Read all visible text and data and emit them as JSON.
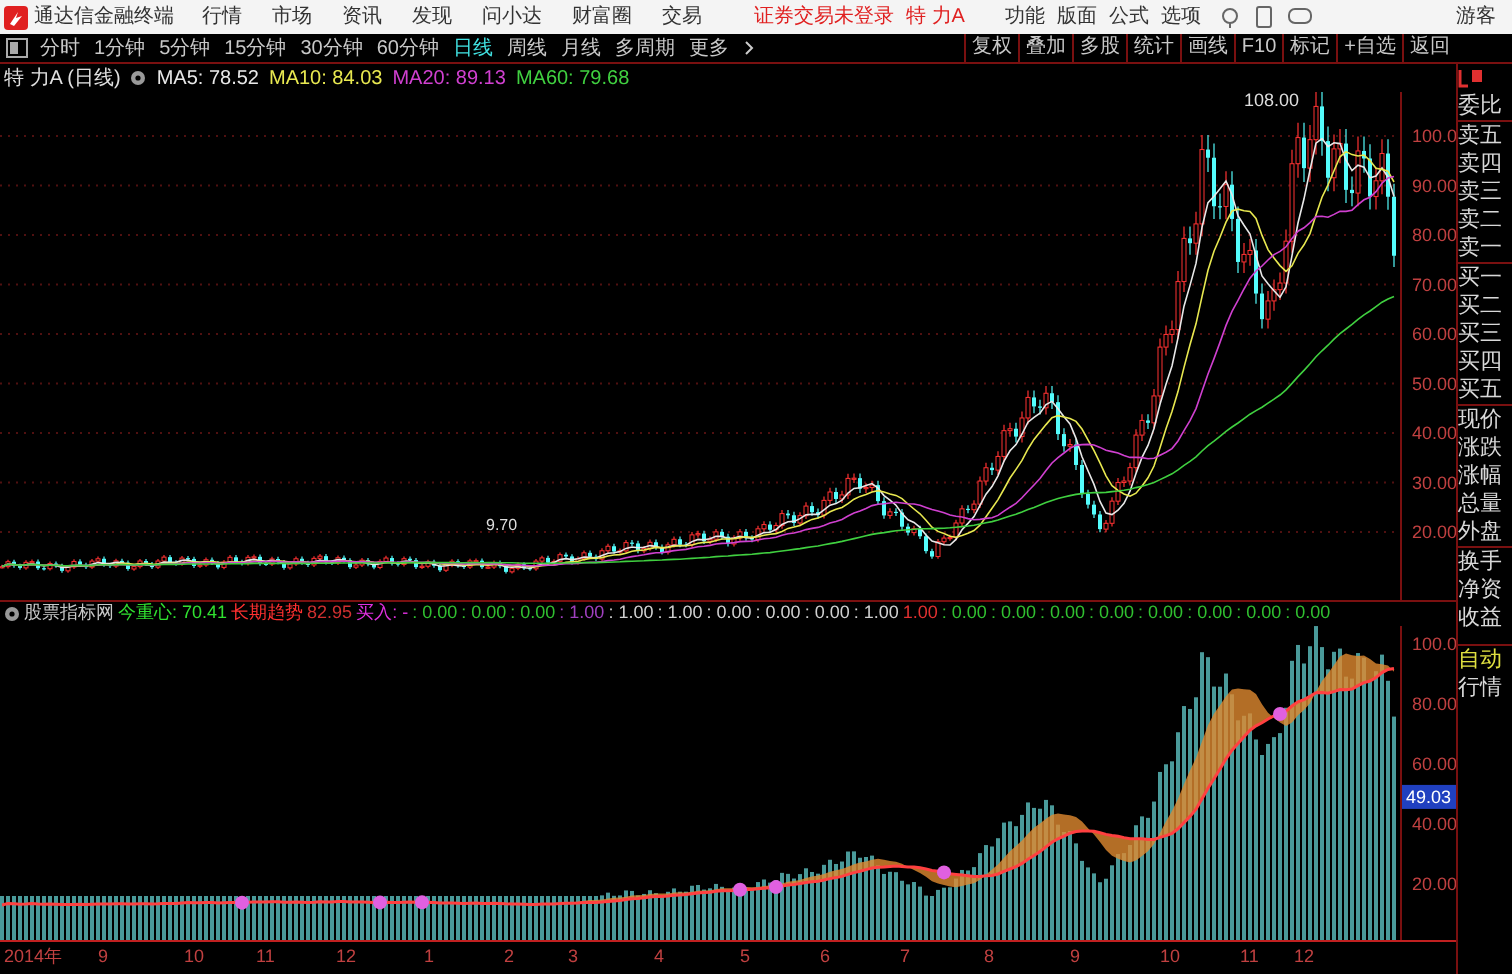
{
  "title_bar": {
    "app_name": "通达信金融终端",
    "menus": [
      "行情",
      "市场",
      "资讯",
      "发现",
      "问小达",
      "财富圈",
      "交易"
    ],
    "login_status": "证券交易未登录",
    "stock": "特 力A",
    "tools": [
      "功能",
      "版面",
      "公式",
      "选项"
    ],
    "user": "游客"
  },
  "period_tabs": [
    {
      "label": "分时",
      "selected": false
    },
    {
      "label": "1分钟",
      "selected": false
    },
    {
      "label": "5分钟",
      "selected": false
    },
    {
      "label": "15分钟",
      "selected": false
    },
    {
      "label": "30分钟",
      "selected": false
    },
    {
      "label": "60分钟",
      "selected": false
    },
    {
      "label": "日线",
      "selected": true
    },
    {
      "label": "周线",
      "selected": false
    },
    {
      "label": "月线",
      "selected": false
    },
    {
      "label": "多周期",
      "selected": false
    },
    {
      "label": "更多",
      "selected": false
    }
  ],
  "toolbar_buttons": [
    "复权",
    "叠加",
    "多股",
    "统计",
    "画线",
    "F10",
    "标记",
    "+自选",
    "返回"
  ],
  "chart_header": {
    "stock": "特 力A (日线)",
    "indicators": [
      {
        "label": "MA5: 78.52",
        "color": "#e8e8e8"
      },
      {
        "label": "MA10: 84.03",
        "color": "#e8e850"
      },
      {
        "label": "MA20: 89.13",
        "color": "#d040d0"
      },
      {
        "label": "MA60: 79.68",
        "color": "#40d040"
      }
    ]
  },
  "price_axis": [
    "100.0",
    "90.00",
    "80.00",
    "70.00",
    "60.00",
    "50.00",
    "40.00",
    "30.00",
    "20.00"
  ],
  "high_label": "108.00",
  "low_label": "9.70",
  "indicator_panel": {
    "name": "股票指标网",
    "values": [
      {
        "text": "今重心: 70.41",
        "color": "#30e030"
      },
      {
        "text": "长期趋势",
        "color": "#ff3030"
      },
      {
        "text": "82.95",
        "color": "#d03030"
      },
      {
        "text": "买入: -",
        "color": "#e030e0"
      },
      {
        "text": ": 0.00",
        "color": "#30c030"
      },
      {
        "text": ": 0.00",
        "color": "#30c030"
      },
      {
        "text": ": 0.00",
        "color": "#30c030"
      },
      {
        "text": ": 1.00",
        "color": "#a040c0"
      },
      {
        "text": ": 1.00",
        "color": "#d0d0d0"
      },
      {
        "text": ": 1.00",
        "color": "#d0d0d0"
      },
      {
        "text": ": 0.00",
        "color": "#d0d0d0"
      },
      {
        "text": ": 0.00",
        "color": "#d0d0d0"
      },
      {
        "text": ": 0.00",
        "color": "#d0d0d0"
      },
      {
        "text": ": 1.00",
        "color": "#d0d0d0"
      },
      {
        "text": "1.00",
        "color": "#e03030"
      },
      {
        "text": ": 0.00",
        "color": "#30c030"
      },
      {
        "text": ": 0.00",
        "color": "#30c030"
      },
      {
        "text": ": 0.00",
        "color": "#30c030"
      },
      {
        "text": ": 0.00",
        "color": "#30c030"
      },
      {
        "text": ": 0.00",
        "color": "#30c030"
      },
      {
        "text": ": 0.00",
        "color": "#30c030"
      },
      {
        "text": ": 0.00",
        "color": "#30c030"
      },
      {
        "text": ": 0.00",
        "color": "#30c030"
      }
    ],
    "axis": [
      "100.0",
      "80.00",
      "60.00",
      "40.00",
      "20.00"
    ],
    "current_value": "49.03"
  },
  "date_axis": [
    "2014年",
    "9",
    "10",
    "11",
    "12",
    "1",
    "2",
    "3",
    "4",
    "5",
    "6",
    "7",
    "8",
    "9",
    "10",
    "11",
    "12"
  ],
  "quote_panel": {
    "labels": [
      "委比",
      "卖五",
      "卖四",
      "卖三",
      "卖二",
      "卖一",
      "买一",
      "买二",
      "买三",
      "买四",
      "买五",
      "现价",
      "涨跌",
      "涨幅",
      "总量",
      "外盘",
      "换手",
      "净资",
      "收益"
    ],
    "modes": [
      {
        "label": "自动",
        "selected": true
      },
      {
        "label": "行情",
        "selected": false
      }
    ]
  }
}
